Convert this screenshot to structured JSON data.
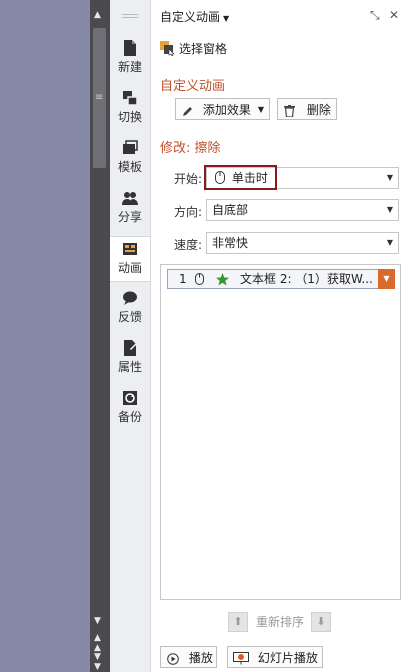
{
  "colors": {
    "accent": "#c0502a",
    "highlight_border": "#8b1a1a",
    "canvas_bg": "#878aa6",
    "item_dropdown": "#d86a2b"
  },
  "sidebar": {
    "tabs": [
      {
        "label": "新建",
        "icon": "new-document-icon"
      },
      {
        "label": "切换",
        "icon": "transition-icon"
      },
      {
        "label": "模板",
        "icon": "template-icon"
      },
      {
        "label": "分享",
        "icon": "share-icon"
      },
      {
        "label": "动画",
        "icon": "animation-icon",
        "active": true
      },
      {
        "label": "反馈",
        "icon": "feedback-icon"
      },
      {
        "label": "属性",
        "icon": "properties-icon"
      },
      {
        "label": "备份",
        "icon": "backup-icon"
      }
    ]
  },
  "panel": {
    "title": "自定义动画",
    "select_pane": "选择窗格",
    "section_custom": "自定义动画",
    "add_effect": "添加效果",
    "delete": "删除",
    "modify_heading": "修改: 擦除",
    "start_label": "开始:",
    "start_value": "单击时",
    "direction_label": "方向:",
    "direction_value": "自底部",
    "speed_label": "速度:",
    "speed_value": "非常快",
    "list_items": [
      {
        "number": "1",
        "text": "文本框 2: （1）获取W..."
      }
    ],
    "reorder": "重新排序",
    "play": "播放",
    "slideshow": "幻灯片播放"
  }
}
